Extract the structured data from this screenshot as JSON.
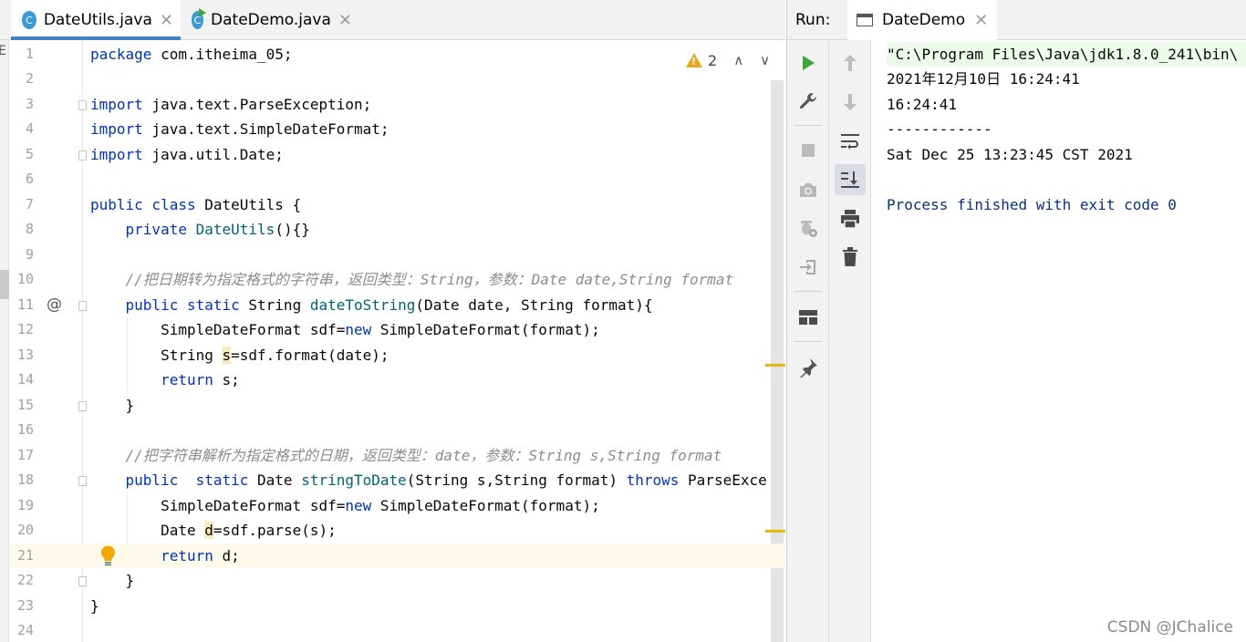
{
  "editor": {
    "tabs": [
      {
        "label": "DateUtils.java",
        "icon": "C",
        "active": true
      },
      {
        "label": "DateDemo.java",
        "icon": "C",
        "active": false
      }
    ],
    "close_glyph": "✕",
    "left_strip_glyph": "E",
    "inspection": {
      "warning_count": "2",
      "up": "⌃",
      "down": "⌄"
    },
    "current_line": 21
  },
  "code_lines": [
    {
      "n": "1",
      "html": "<span class=\"kw\">package</span> com.itheima_05;"
    },
    {
      "n": "2",
      "html": ""
    },
    {
      "n": "3",
      "html": "<span class=\"kw\">import</span> java.text.ParseException;"
    },
    {
      "n": "4",
      "html": "<span class=\"kw\">import</span> java.text.SimpleDateFormat;"
    },
    {
      "n": "5",
      "html": "<span class=\"kw\">import</span> java.util.Date;"
    },
    {
      "n": "6",
      "html": ""
    },
    {
      "n": "7",
      "html": "<span class=\"kw\">public class</span> DateUtils {"
    },
    {
      "n": "8",
      "html": "    <span class=\"kw\">private</span> <span class=\"fn\">DateUtils</span>(){}"
    },
    {
      "n": "9",
      "html": ""
    },
    {
      "n": "10",
      "html": "    <span class=\"cm\">//把日期转为指定格式的字符串，返回类型：String，参数：Date date,String format</span>"
    },
    {
      "n": "11",
      "html": "    <span class=\"kw\">public static</span> String <span class=\"fn\">dateToString</span>(Date date, String format){"
    },
    {
      "n": "12",
      "html": "        SimpleDateFormat sdf=<span class=\"kw\">new</span> SimpleDateFormat(format);"
    },
    {
      "n": "13",
      "html": "        String <span class=\"hl\">s</span>=sdf.format(date);"
    },
    {
      "n": "14",
      "html": "        <span class=\"kw\">return</span> s;"
    },
    {
      "n": "15",
      "html": "    }"
    },
    {
      "n": "16",
      "html": ""
    },
    {
      "n": "17",
      "html": "    <span class=\"cm\">//把字符串解析为指定格式的日期，返回类型：date，参数：String s,String format</span>"
    },
    {
      "n": "18",
      "html": "    <span class=\"kw\">public</span>  <span class=\"kw\">static</span> Date <span class=\"fn\">stringToDate</span>(String s,String format) <span class=\"kw\">throws</span> ParseExce"
    },
    {
      "n": "19",
      "html": "        SimpleDateFormat sdf=<span class=\"kw\">new</span> SimpleDateFormat(format);"
    },
    {
      "n": "20",
      "html": "        Date <span class=\"hl\">d</span>=sdf.parse(s);"
    },
    {
      "n": "21",
      "html": "        <span class=\"kw\">return</span> d;"
    },
    {
      "n": "22",
      "html": "    }"
    },
    {
      "n": "23",
      "html": "}"
    },
    {
      "n": "24",
      "html": ""
    }
  ],
  "gutter_marks": {
    "override_line": "11",
    "override_glyph": "@",
    "bulb_line": "21"
  },
  "run": {
    "label": "Run:",
    "tab_label": "DateDemo",
    "output": [
      {
        "text": "\"C:\\Program Files\\Java\\jdk1.8.0_241\\bin\\",
        "kind": "cmd"
      },
      {
        "text": "2021年12月10日 16:24:41",
        "kind": "out"
      },
      {
        "text": "16:24:41",
        "kind": "out"
      },
      {
        "text": "------------",
        "kind": "out"
      },
      {
        "text": "Sat Dec 25 13:23:45 CST 2021",
        "kind": "out"
      },
      {
        "text": "",
        "kind": "out"
      },
      {
        "text": "Process finished with exit code 0",
        "kind": "proc"
      }
    ]
  },
  "watermark": "CSDN @JChalice",
  "colors": {
    "keyword": "#0033b3",
    "function": "#00627a",
    "comment": "#8c8c8c",
    "run_green": "#40a33c",
    "warning": "#e3a823"
  }
}
